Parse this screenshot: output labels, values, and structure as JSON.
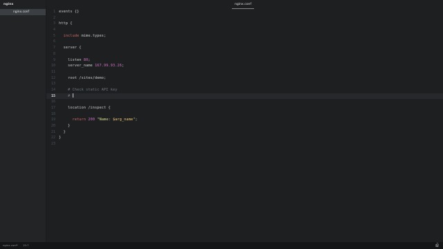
{
  "sidebar": {
    "folder_name": "nginx",
    "files": [
      {
        "label": "nginx.conf"
      }
    ]
  },
  "editor": {
    "tab_label": "nginx.conf",
    "current_line": 15,
    "lines": [
      {
        "n": "1",
        "seg": [
          [
            "t",
            "events {}"
          ]
        ]
      },
      {
        "n": "2",
        "seg": []
      },
      {
        "n": "3",
        "seg": [
          [
            "t",
            "http {"
          ]
        ]
      },
      {
        "n": "4",
        "seg": []
      },
      {
        "n": "5",
        "seg": [
          [
            "t",
            "  "
          ],
          [
            "kw",
            "include"
          ],
          [
            "t",
            " mime.types;"
          ]
        ]
      },
      {
        "n": "6",
        "seg": []
      },
      {
        "n": "7",
        "seg": [
          [
            "t",
            "  server {"
          ]
        ]
      },
      {
        "n": "8",
        "seg": []
      },
      {
        "n": "9",
        "seg": [
          [
            "t",
            "    listen "
          ],
          [
            "num",
            "80"
          ],
          [
            "t",
            ";"
          ]
        ]
      },
      {
        "n": "10",
        "seg": [
          [
            "t",
            "    server_name "
          ],
          [
            "num",
            "167.99.93.26"
          ],
          [
            "t",
            ";"
          ]
        ]
      },
      {
        "n": "11",
        "seg": []
      },
      {
        "n": "12",
        "seg": [
          [
            "t",
            "    root /sites/demo;"
          ]
        ]
      },
      {
        "n": "13",
        "seg": []
      },
      {
        "n": "14",
        "seg": [
          [
            "t",
            "    "
          ],
          [
            "cmt",
            "# Check static API key"
          ]
        ]
      },
      {
        "n": "15",
        "seg": [
          [
            "t",
            "    "
          ],
          [
            "cmt",
            "# "
          ]
        ],
        "cursor": true
      },
      {
        "n": "16",
        "seg": []
      },
      {
        "n": "17",
        "seg": [
          [
            "t",
            "    location /inspect {"
          ]
        ]
      },
      {
        "n": "18",
        "seg": []
      },
      {
        "n": "19",
        "seg": [
          [
            "t",
            "      "
          ],
          [
            "kw",
            "return"
          ],
          [
            "t",
            " "
          ],
          [
            "num",
            "200"
          ],
          [
            "t",
            " "
          ],
          [
            "str",
            "\"Name: "
          ],
          [
            "var",
            "$arg_name"
          ],
          [
            "str",
            "\""
          ],
          [
            "t",
            ";"
          ]
        ]
      },
      {
        "n": "20",
        "seg": [
          [
            "t",
            "    }"
          ]
        ]
      },
      {
        "n": "21",
        "seg": [
          [
            "t",
            "  }"
          ]
        ]
      },
      {
        "n": "22",
        "seg": [
          [
            "t",
            "}"
          ]
        ]
      },
      {
        "n": "23",
        "seg": []
      }
    ]
  },
  "status_bar": {
    "file": "nginx.conf*",
    "position": "15:7"
  },
  "watermark": {
    "text": "ᵘdemy"
  }
}
